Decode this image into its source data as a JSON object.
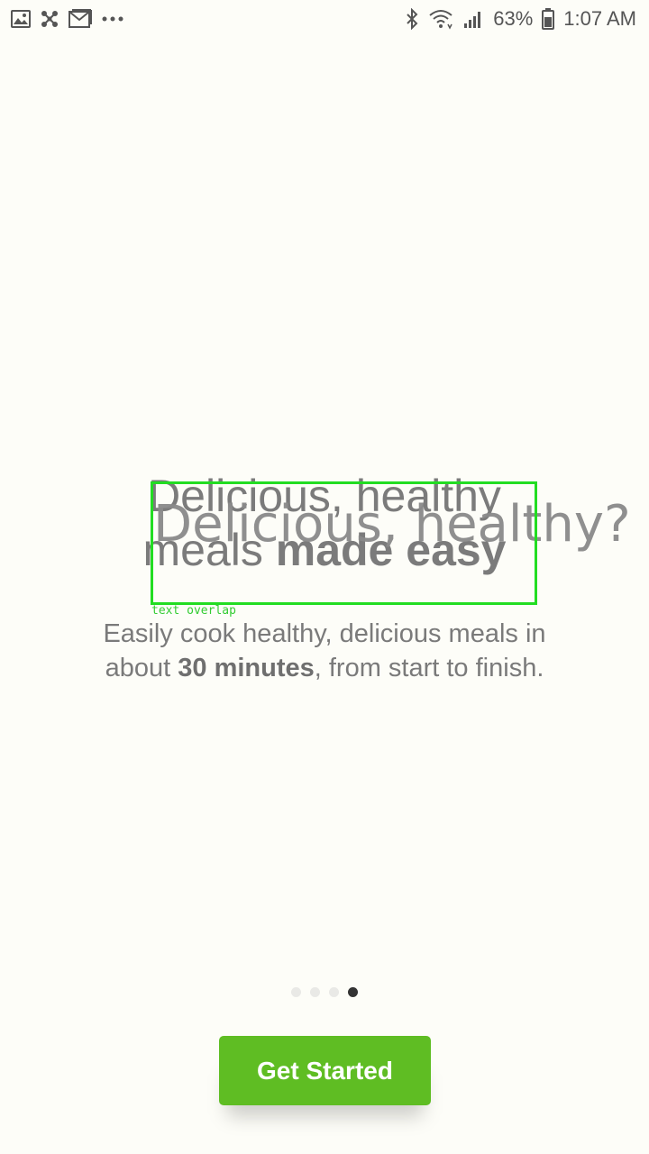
{
  "status_bar": {
    "left_icons": [
      "gallery-icon",
      "fan-icon",
      "gmail-icon",
      "more-icon"
    ],
    "right_icons": [
      "bluetooth-icon",
      "wifi-icon",
      "signal-icon",
      "battery-icon"
    ],
    "battery_text": "63%",
    "time": "1:07 AM"
  },
  "onboarding": {
    "headline_line1": "Delicious, healthy",
    "headline_line2_prefix": "meals ",
    "headline_line2_bold": "made easy",
    "overlay_text": "Delicious, healthy?",
    "overlay_caption": "text overlap",
    "subtext_prefix": "Easily cook healthy, delicious meals in about ",
    "subtext_bold": "30 minutes",
    "subtext_suffix": ", from start to finish."
  },
  "pager": {
    "count": 4,
    "active_index": 3
  },
  "cta": {
    "label": "Get Started",
    "color": "#5fbd23"
  }
}
